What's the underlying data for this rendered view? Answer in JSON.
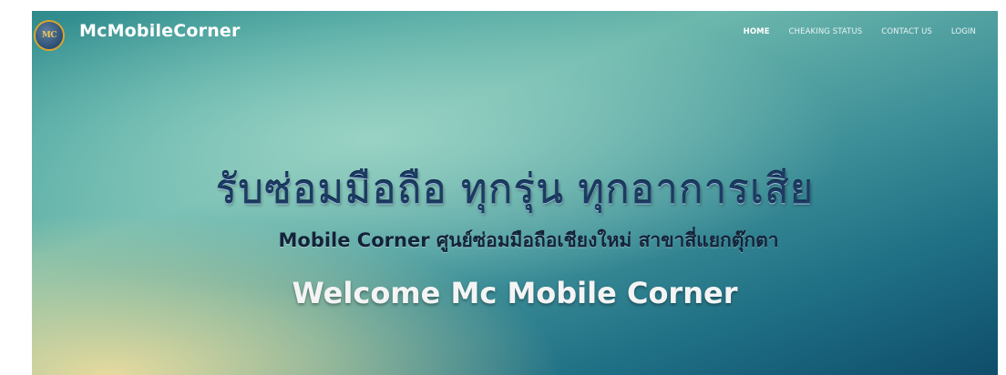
{
  "brand": {
    "name": "McMobileCorner",
    "logo_text": "MC"
  },
  "nav": {
    "items": [
      {
        "label": "HOME",
        "active": true
      },
      {
        "label": "CHEAKING STATUS",
        "active": false
      },
      {
        "label": "CONTACT US",
        "active": false
      },
      {
        "label": "LOGIN",
        "active": false
      }
    ]
  },
  "hero": {
    "headline": "รับซ่อมมือถือ ทุกรุ่น ทุกอาการเสีย",
    "subheadline": "Mobile Corner ศูนย์ซ่อมมือถือเชียงใหม่ สาขาสี่แยกตุ๊กตา",
    "welcome": "Welcome Mc Mobile Corner"
  },
  "colors": {
    "accent_logo_ring": "#e0a428",
    "headline_text": "#1c3b63",
    "welcome_text": "#f4f4f4"
  }
}
